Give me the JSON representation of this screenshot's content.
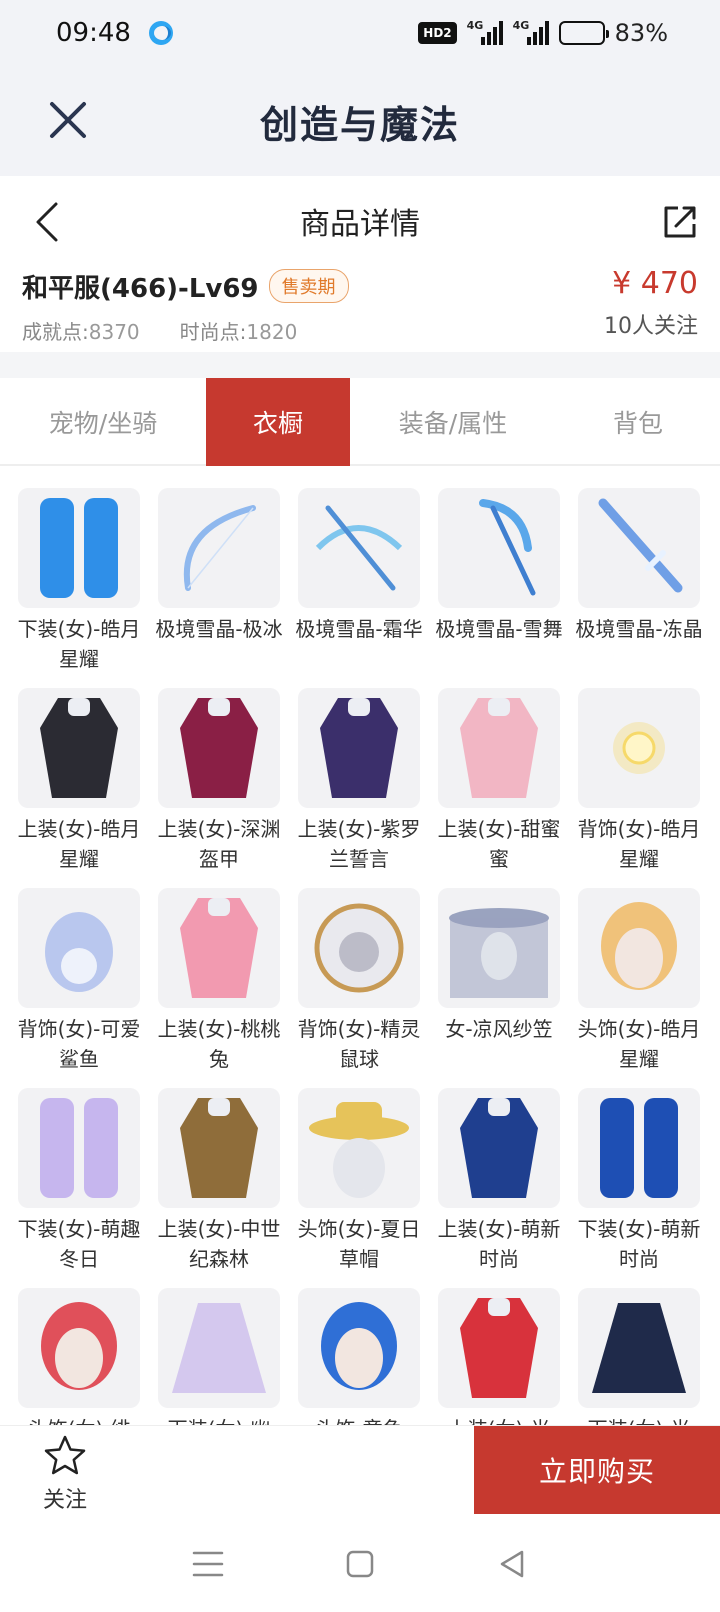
{
  "status_bar": {
    "time": "09:48",
    "hd_label": "HD2",
    "network_1": "4G",
    "network_2": "4G",
    "battery_percent": "83%",
    "battery_level": 0.83
  },
  "app_header": {
    "title": "创造与魔法"
  },
  "sub_header": {
    "title": "商品详情"
  },
  "product": {
    "name": "和平服(466)-Lv69",
    "badge": "售卖期",
    "price": "¥ 470",
    "achievement_label": "成就点:",
    "achievement_value": "8370",
    "fashion_label": "时尚点:",
    "fashion_value": "1820",
    "followers": "10人关注"
  },
  "tabs": [
    {
      "label": "宠物/坐骑",
      "active": false
    },
    {
      "label": "衣橱",
      "active": true
    },
    {
      "label": "装备/属性",
      "active": false
    },
    {
      "label": "背包",
      "active": false
    }
  ],
  "items": [
    {
      "name": "下装(女)-皓月星耀",
      "icon": "blue-skirt",
      "color": "#2f8fe8"
    },
    {
      "name": "极境雪晶-极冰",
      "icon": "ice-bow",
      "color": "#8fb8ee"
    },
    {
      "name": "极境雪晶-霜华",
      "icon": "ice-crossbow",
      "color": "#7fc6ee"
    },
    {
      "name": "极境雪晶-雪舞",
      "icon": "ice-scythe",
      "color": "#5aa7ea"
    },
    {
      "name": "极境雪晶-冻晶",
      "icon": "ice-sword",
      "color": "#6f9fe6"
    },
    {
      "name": "上装(女)-皓月星耀",
      "icon": "black-top",
      "color": "#2b2b33"
    },
    {
      "name": "上装(女)-深渊盔甲",
      "icon": "abyss-armor",
      "color": "#8a1f45"
    },
    {
      "name": "上装(女)-紫罗兰誓言",
      "icon": "violet-dress",
      "color": "#3b2f6b"
    },
    {
      "name": "上装(女)-甜蜜蜜",
      "icon": "pink-dress",
      "color": "#f2b6c4"
    },
    {
      "name": "背饰(女)-皓月星耀",
      "icon": "glow-orb",
      "color": "#f6d96a"
    },
    {
      "name": "背饰(女)-可爱鲨鱼",
      "icon": "shark-plush",
      "color": "#b9c7ee"
    },
    {
      "name": "上装(女)-桃桃兔",
      "icon": "pink-plaid-top",
      "color": "#f29ab0"
    },
    {
      "name": "背饰(女)-精灵鼠球",
      "icon": "mouse-ball",
      "color": "#c79a55"
    },
    {
      "name": "女-凉风纱笠",
      "icon": "veil-hat",
      "color": "#9aa3bf"
    },
    {
      "name": "头饰(女)-皓月星耀",
      "icon": "blonde-head",
      "color": "#f0c27a"
    },
    {
      "name": "下装(女)-萌趣冬日",
      "icon": "lavender-boots",
      "color": "#c6b6ee"
    },
    {
      "name": "上装(女)-中世纪森林",
      "icon": "forest-top",
      "color": "#8f6d3a"
    },
    {
      "name": "头饰(女)-夏日草帽",
      "icon": "straw-hat",
      "color": "#e6c35a"
    },
    {
      "name": "上装(女)-萌新时尚",
      "icon": "navy-corset",
      "color": "#1f3f8f"
    },
    {
      "name": "下装(女)-萌新时尚",
      "icon": "blue-pants",
      "color": "#1e4fb4"
    },
    {
      "name": "头饰(女)-绯",
      "icon": "red-horn-head",
      "color": "#e0505a"
    },
    {
      "name": "下装(女)-幽",
      "icon": "lilac-skirt",
      "color": "#d4c8ee"
    },
    {
      "name": "头饰-章鱼",
      "icon": "octopus-hat",
      "color": "#2f6fd6"
    },
    {
      "name": "上装(女)-光",
      "icon": "red-jacket",
      "color": "#d8323c"
    },
    {
      "name": "下装(女)-光",
      "icon": "pleated-skirt",
      "color": "#1f2a4a"
    }
  ],
  "bottom": {
    "follow_label": "关注",
    "buy_label": "立即购买"
  },
  "colors": {
    "accent": "#c6392f",
    "price": "#c83a2e",
    "badge": "#e07a2b"
  }
}
